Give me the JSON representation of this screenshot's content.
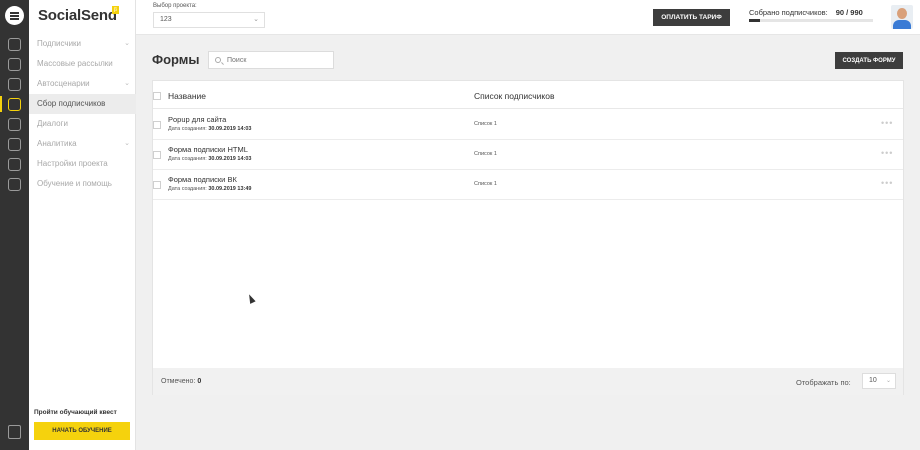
{
  "brand": {
    "name": "SocialSend",
    "badge": "β"
  },
  "sidebar": {
    "items": [
      {
        "label": "Подписчики",
        "has_chevron": true
      },
      {
        "label": "Массовые рассылки",
        "has_chevron": false
      },
      {
        "label": "Автосценарии",
        "has_chevron": true
      },
      {
        "label": "Сбор подписчиков",
        "has_chevron": false,
        "active": true
      },
      {
        "label": "Диалоги",
        "has_chevron": false
      },
      {
        "label": "Аналитика",
        "has_chevron": true
      },
      {
        "label": "Настройки проекта",
        "has_chevron": false
      },
      {
        "label": "Обучение и помощь",
        "has_chevron": false
      }
    ],
    "quest_text": "Пройти обучающий квест",
    "start_button": "НАЧАТЬ ОБУЧЕНИЕ"
  },
  "header": {
    "project_label": "Выбор проекта:",
    "project_value": "123",
    "pay_button": "ОПЛАТИТЬ ТАРИФ",
    "collected_label": "Собрано подписчиков:",
    "collected_value": "90 / 990",
    "collected_fraction": 0.09
  },
  "main": {
    "title": "Формы",
    "search_placeholder": "Поиск",
    "create_button": "СОЗДАТЬ ФОРМУ",
    "columns": {
      "name": "Название",
      "list": "Список подписчиков"
    },
    "date_prefix": "Дата создания:",
    "rows": [
      {
        "name": "Popup для сайта",
        "date": "30.09.2019 14:03",
        "list": "Список 1"
      },
      {
        "name": "Форма подписки HTML",
        "date": "30.09.2019 14:03",
        "list": "Список 1"
      },
      {
        "name": "Форма подписки ВК",
        "date": "30.09.2019 13:49",
        "list": "Список 1"
      }
    ],
    "footer": {
      "selected_label": "Отмечено:",
      "selected_value": "0",
      "per_page_label": "Отображать по:",
      "per_page_value": "10"
    }
  },
  "colors": {
    "accent": "#f5d20d",
    "rail": "#333333",
    "dark_button": "#3d3d3d"
  }
}
